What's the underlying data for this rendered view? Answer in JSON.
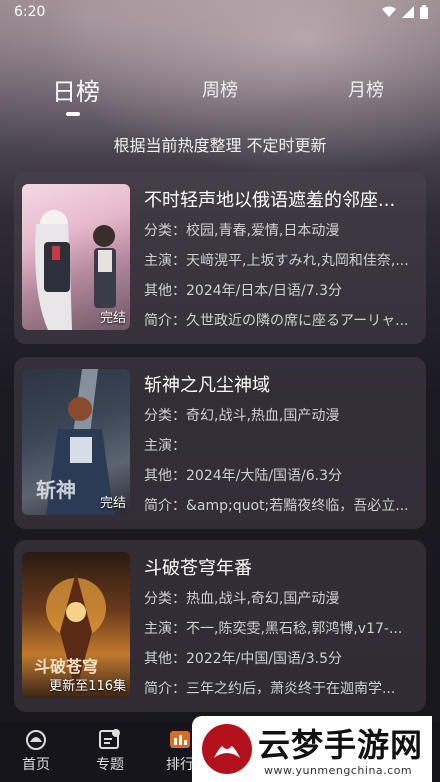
{
  "status_bar": {
    "time": "6:20"
  },
  "tabs": [
    {
      "label": "日榜",
      "active": true
    },
    {
      "label": "周榜",
      "active": false
    },
    {
      "label": "月榜",
      "active": false
    }
  ],
  "subtitle": "根据当前热度整理 不定时更新",
  "cards": [
    {
      "title": "不时轻声地以俄语遮羞的邻座...",
      "badge": "完结",
      "category": "分类：校园,青春,爱情,日本动漫",
      "cast": "主演：天﨑滉平,上坂すみれ,丸岡和佳奈,...",
      "other": "其他：2024年/日本/日语/7.3分",
      "intro": "简介：久世政近の隣の席に座るアーリャ..."
    },
    {
      "title": "斩神之凡尘神域",
      "badge": "完结",
      "category": "分类：奇幻,战斗,热血,国产动漫",
      "cast": "主演：",
      "other": "其他：2024年/大陆/国语/6.3分",
      "intro": "简介：&amp;quot;若黯夜终临，吾必立..."
    },
    {
      "title": "斗破苍穹年番",
      "badge": "更新至116集",
      "category": "分类：热血,战斗,奇幻,国产动漫",
      "cast": "主演：不一,陈奕雯,黑石稔,郭鸿博,v17-...",
      "other": "其他：2022年/中国/国语/3.5分",
      "intro": "简介：三年之约后，萧炎终于在迦南学..."
    }
  ],
  "bottom_nav": [
    {
      "label": "首页",
      "icon": "home-icon"
    },
    {
      "label": "专题",
      "icon": "topic-icon"
    },
    {
      "label": "排行",
      "icon": "ranking-icon"
    }
  ],
  "watermark": {
    "name": "云梦手游网",
    "url": "www.yunmengchina.com"
  }
}
